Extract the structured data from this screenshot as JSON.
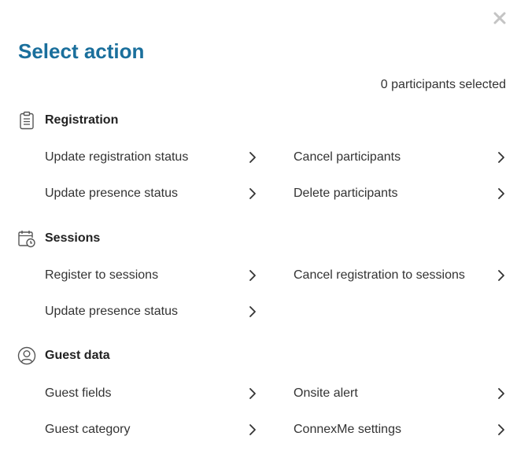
{
  "dialog": {
    "title": "Select action",
    "selected_count": "0 participants selected",
    "close_icon": "close-icon"
  },
  "sections": [
    {
      "title": "Registration",
      "icon": "clipboard-icon",
      "actions": [
        {
          "label": "Update registration status"
        },
        {
          "label": "Cancel participants"
        },
        {
          "label": "Update presence status"
        },
        {
          "label": "Delete participants"
        }
      ]
    },
    {
      "title": "Sessions",
      "icon": "calendar-clock-icon",
      "actions": [
        {
          "label": "Register to sessions"
        },
        {
          "label": "Cancel registration to sessions"
        },
        {
          "label": "Update presence status"
        }
      ]
    },
    {
      "title": "Guest data",
      "icon": "user-circle-icon",
      "actions": [
        {
          "label": "Guest fields"
        },
        {
          "label": "Onsite alert"
        },
        {
          "label": "Guest category"
        },
        {
          "label": "ConnexMe settings"
        }
      ]
    }
  ],
  "colors": {
    "title": "#1a6f9c",
    "close": "#c4c4c4",
    "text": "#333333"
  }
}
